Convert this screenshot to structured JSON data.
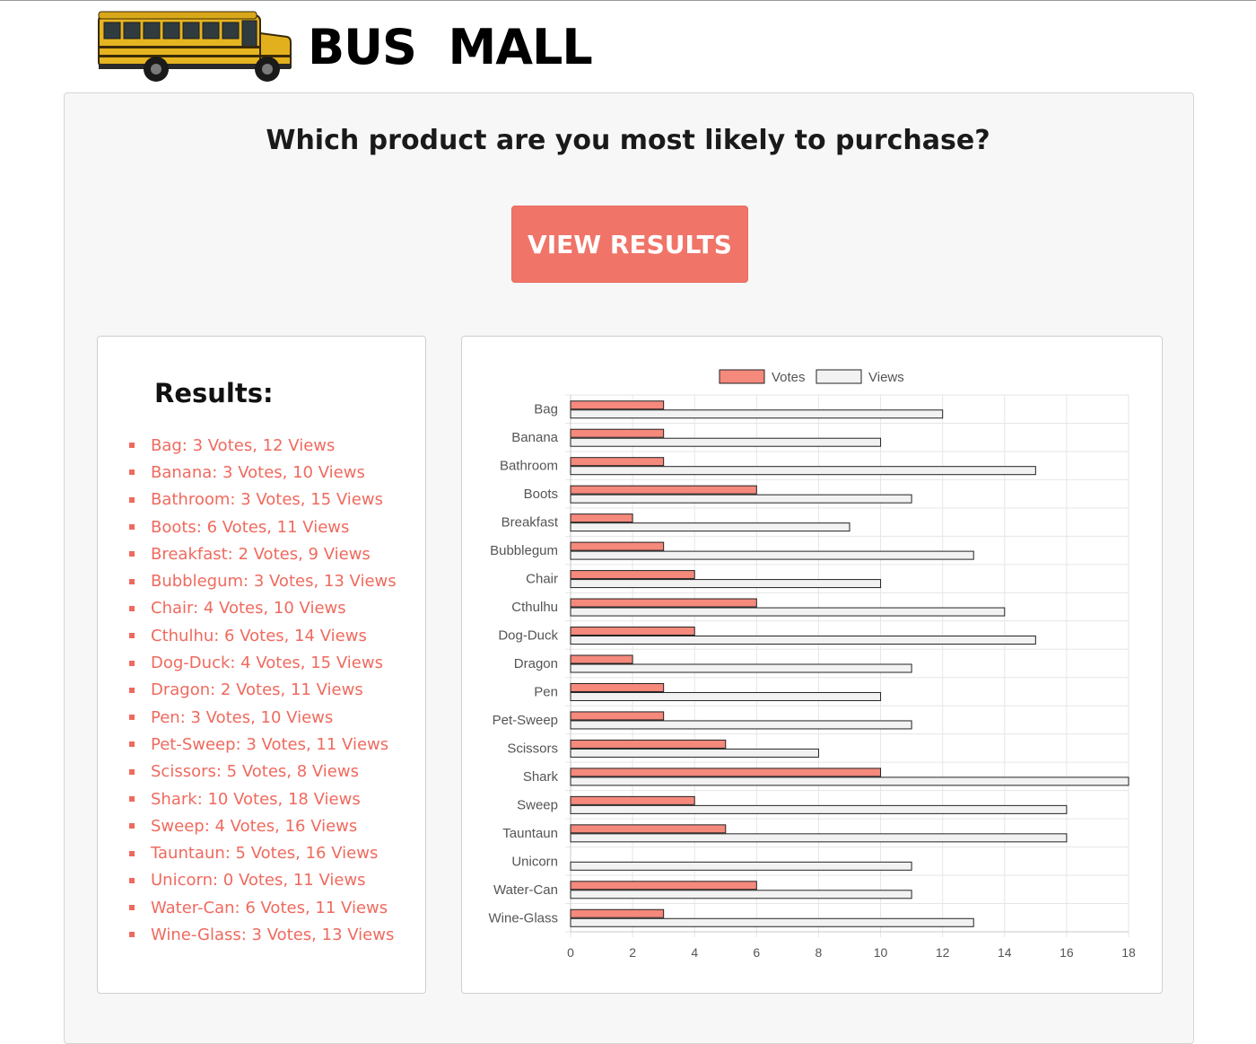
{
  "header": {
    "brand": "BUS  MALL",
    "logo_icon": "school-bus-icon"
  },
  "main": {
    "question": "Which product are you most likely to purchase?",
    "view_results_label": "VIEW RESULTS",
    "results_title": "Results:"
  },
  "results": [
    "Bag: 3 Votes, 12 Views",
    "Banana: 3 Votes, 10 Views",
    "Bathroom: 3 Votes, 15 Views",
    "Boots: 6 Votes, 11 Views",
    "Breakfast: 2 Votes, 9 Views",
    "Bubblegum: 3 Votes, 13 Views",
    "Chair: 4 Votes, 10 Views",
    "Cthulhu: 6 Votes, 14 Views",
    "Dog-Duck: 4 Votes, 15 Views",
    "Dragon: 2 Votes, 11 Views",
    "Pen: 3 Votes, 10 Views",
    "Pet-Sweep: 3 Votes, 11 Views",
    "Scissors: 5 Votes, 8 Views",
    "Shark: 10 Votes, 18 Views",
    "Sweep: 4 Votes, 16 Views",
    "Tauntaun: 5 Votes, 16 Views",
    "Unicorn: 0 Votes, 11 Views",
    "Water-Can: 6 Votes, 11 Views",
    "Wine-Glass: 3 Votes, 13 Views"
  ],
  "colors": {
    "accent": "#f07468",
    "votes_fill": "#f4897c",
    "views_fill": "#f2f2f2"
  },
  "chart_data": {
    "type": "bar",
    "orientation": "horizontal",
    "categories": [
      "Bag",
      "Banana",
      "Bathroom",
      "Boots",
      "Breakfast",
      "Bubblegum",
      "Chair",
      "Cthulhu",
      "Dog-Duck",
      "Dragon",
      "Pen",
      "Pet-Sweep",
      "Scissors",
      "Shark",
      "Sweep",
      "Tauntaun",
      "Unicorn",
      "Water-Can",
      "Wine-Glass"
    ],
    "series": [
      {
        "name": "Votes",
        "values": [
          3,
          3,
          3,
          6,
          2,
          3,
          4,
          6,
          4,
          2,
          3,
          3,
          5,
          10,
          4,
          5,
          0,
          6,
          3
        ]
      },
      {
        "name": "Views",
        "values": [
          12,
          10,
          15,
          11,
          9,
          13,
          10,
          14,
          15,
          11,
          10,
          11,
          8,
          18,
          16,
          16,
          11,
          11,
          13
        ]
      }
    ],
    "xlim": [
      0,
      18
    ],
    "xticks": [
      0,
      2,
      4,
      6,
      8,
      10,
      12,
      14,
      16,
      18
    ],
    "grid": true,
    "legend": "top"
  }
}
